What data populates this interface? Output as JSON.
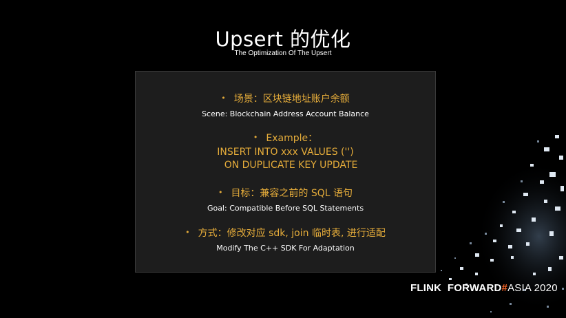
{
  "slide": {
    "title": "Upsert 的优化",
    "subtitle": "The Optimization Of The Upsert"
  },
  "items": [
    {
      "bullet": "•",
      "lines": [
        "场景：区块链地址账户余额"
      ],
      "sub": "Scene: Blockchain Address Account Balance"
    },
    {
      "bullet": "•",
      "lines": [
        "Example：",
        "INSERT INTO xxx VALUES ('')",
        "ON DUPLICATE KEY UPDATE"
      ]
    },
    {
      "bullet": "•",
      "lines": [
        "目标：兼容之前的 SQL 语句"
      ],
      "sub": "Goal: Compatible Before SQL Statements"
    },
    {
      "bullet": "•",
      "lines": [
        "方式：修改对应 sdk, join 临时表, 进行适配"
      ],
      "sub": "Modify The C++ SDK For Adaptation"
    }
  ],
  "brand": {
    "main": "FLINK  FORWARD",
    "hash": "#",
    "tail": "ASIA 2020"
  },
  "colors": {
    "background": "#000000",
    "panel": "#1d1d1d",
    "accent_text": "#e5ac3a",
    "brand_hash": "#ff6a2a"
  }
}
